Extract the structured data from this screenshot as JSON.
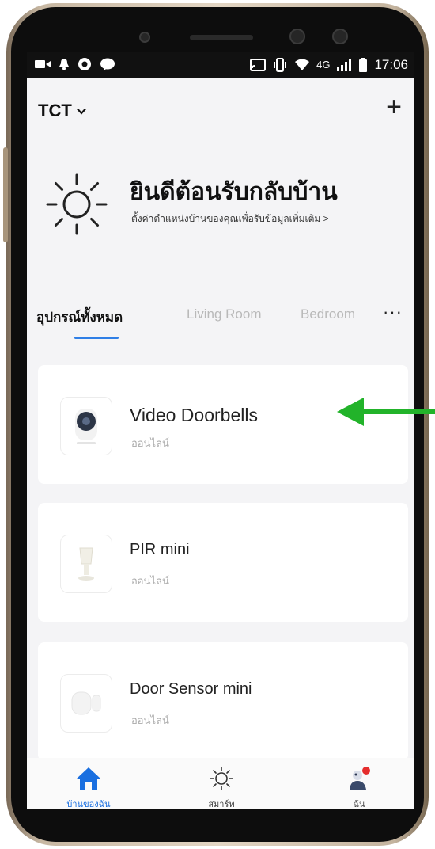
{
  "status_bar": {
    "left_icons": [
      "video-camera-icon",
      "notification-bell-icon",
      "aperture-icon",
      "line-chat-icon"
    ],
    "right_icons": [
      "cast-icon",
      "vibrate-icon",
      "wifi-icon",
      "signal-icon",
      "battery-icon"
    ],
    "network": "4G",
    "time": "17:06"
  },
  "header": {
    "home_name": "TCT",
    "add_button": "+"
  },
  "welcome": {
    "title": "ยินดีต้อนรับกลับบ้าน",
    "subtitle": "ตั้งค่าตำแหน่งบ้านของคุณเพื่อรับข้อมูลเพิ่มเติม >"
  },
  "tabs": [
    {
      "label": "อุปกรณ์ทั้งหมด",
      "active": true
    },
    {
      "label": "Living Room",
      "active": false
    },
    {
      "label": "Bedroom",
      "active": false
    }
  ],
  "more_tabs": "···",
  "devices": [
    {
      "name": "Video Doorbells",
      "status": "ออนไลน์",
      "icon": "doorbell-camera-icon"
    },
    {
      "name": "PIR mini",
      "status": "ออนไลน์",
      "icon": "pir-sensor-icon"
    },
    {
      "name": "Door Sensor mini",
      "status": "ออนไลน์",
      "icon": "door-sensor-icon"
    }
  ],
  "bottom_nav": [
    {
      "label": "บ้านของฉัน",
      "icon": "home-icon",
      "active": true
    },
    {
      "label": "สมาร์ท",
      "icon": "sun-icon",
      "active": false
    },
    {
      "label": "ฉัน",
      "icon": "profile-avatar-icon",
      "active": false
    }
  ],
  "colors": {
    "accent": "#1a6fe0",
    "annotation_arrow": "#22b32a",
    "background": "#f4f4f6"
  }
}
